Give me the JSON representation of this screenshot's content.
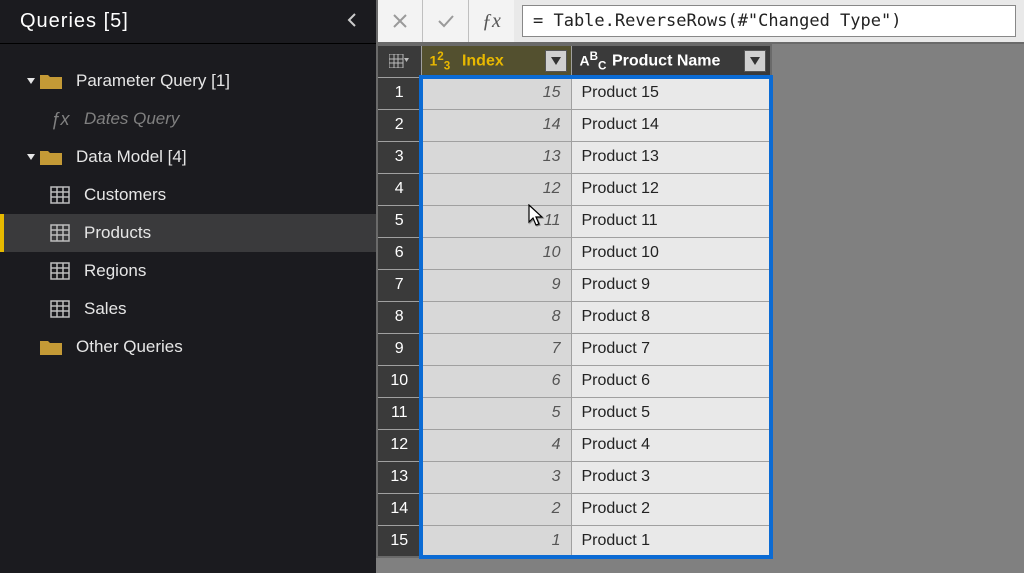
{
  "sidebar": {
    "title": "Queries [5]",
    "folders": {
      "param": {
        "label": "Parameter Query [1]"
      },
      "model": {
        "label": "Data Model [4]"
      },
      "other": {
        "label": "Other Queries"
      }
    },
    "leaves": {
      "dates": "Dates Query",
      "customers": "Customers",
      "products": "Products",
      "regions": "Regions",
      "sales": "Sales"
    }
  },
  "formula": "= Table.ReverseRows(#\"Changed Type\")",
  "columns": {
    "index": "Index",
    "name": "Product Name"
  },
  "rows": [
    {
      "n": 1,
      "index": 15,
      "name": "Product 15"
    },
    {
      "n": 2,
      "index": 14,
      "name": "Product 14"
    },
    {
      "n": 3,
      "index": 13,
      "name": "Product 13"
    },
    {
      "n": 4,
      "index": 12,
      "name": "Product 12"
    },
    {
      "n": 5,
      "index": 11,
      "name": "Product 11"
    },
    {
      "n": 6,
      "index": 10,
      "name": "Product 10"
    },
    {
      "n": 7,
      "index": 9,
      "name": "Product 9"
    },
    {
      "n": 8,
      "index": 8,
      "name": "Product 8"
    },
    {
      "n": 9,
      "index": 7,
      "name": "Product 7"
    },
    {
      "n": 10,
      "index": 6,
      "name": "Product 6"
    },
    {
      "n": 11,
      "index": 5,
      "name": "Product 5"
    },
    {
      "n": 12,
      "index": 4,
      "name": "Product 4"
    },
    {
      "n": 13,
      "index": 3,
      "name": "Product 3"
    },
    {
      "n": 14,
      "index": 2,
      "name": "Product 2"
    },
    {
      "n": 15,
      "index": 1,
      "name": "Product 1"
    }
  ]
}
